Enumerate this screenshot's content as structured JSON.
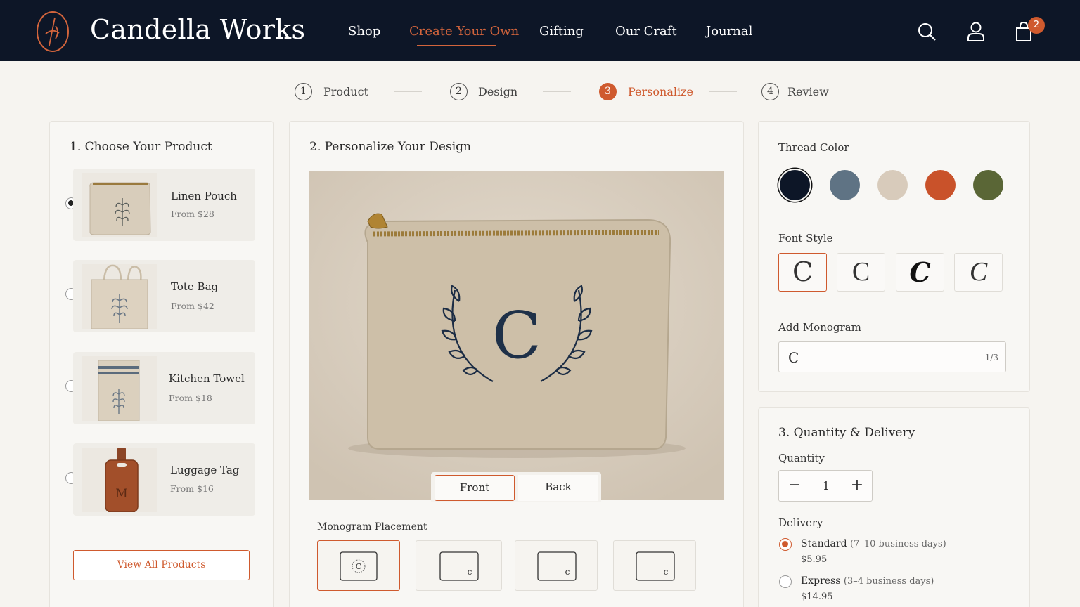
{
  "brand": "Candella Works",
  "nav": [
    "Shop",
    "Create Your Own",
    "Gifting",
    "Our Craft",
    "Journal"
  ],
  "cart_count": "2",
  "steps": [
    {
      "num": "1",
      "label": "Product"
    },
    {
      "num": "2",
      "label": "Design"
    },
    {
      "num": "3",
      "label": "Personalize"
    },
    {
      "num": "4",
      "label": "Review"
    }
  ],
  "products": {
    "title": "1. Choose Your Product",
    "items": [
      {
        "name": "Linen Pouch",
        "price": "From $28"
      },
      {
        "name": "Tote Bag",
        "price": "From $42"
      },
      {
        "name": "Kitchen Towel",
        "price": "From $18"
      },
      {
        "name": "Luggage Tag",
        "price": "From $16"
      }
    ],
    "tag_letter": "M",
    "view_all": "View All Products"
  },
  "design": {
    "title": "2. Personalize Your Design",
    "preview_letter": "C",
    "tabs": [
      "Front",
      "Back"
    ],
    "placement_label": "Monogram Placement",
    "placement_letters": [
      "C",
      "c",
      "c",
      "c"
    ]
  },
  "options": {
    "thread_label": "Thread Color",
    "thread_colors": [
      "#0d1627",
      "#5f7384",
      "#d8cbbb",
      "#c9522a",
      "#5a6636"
    ],
    "font_label": "Font Style",
    "font_glyphs": [
      "C",
      "C",
      "C",
      "C"
    ],
    "monogram_label": "Add Monogram",
    "monogram_value": "C",
    "monogram_count": "1/3"
  },
  "delivery": {
    "title": "3. Quantity & Delivery",
    "quantity_label": "Quantity",
    "minus": "−",
    "quantity": "1",
    "plus": "+",
    "delivery_label": "Delivery",
    "options": [
      {
        "name": "Standard",
        "detail": "(7–10 business days)",
        "price": "$5.95"
      },
      {
        "name": "Express",
        "detail": "(3–4 business days)",
        "price": "$14.95"
      }
    ]
  },
  "colors": {
    "accent": "#cf5a2e",
    "header_bg": "#0d1627"
  }
}
